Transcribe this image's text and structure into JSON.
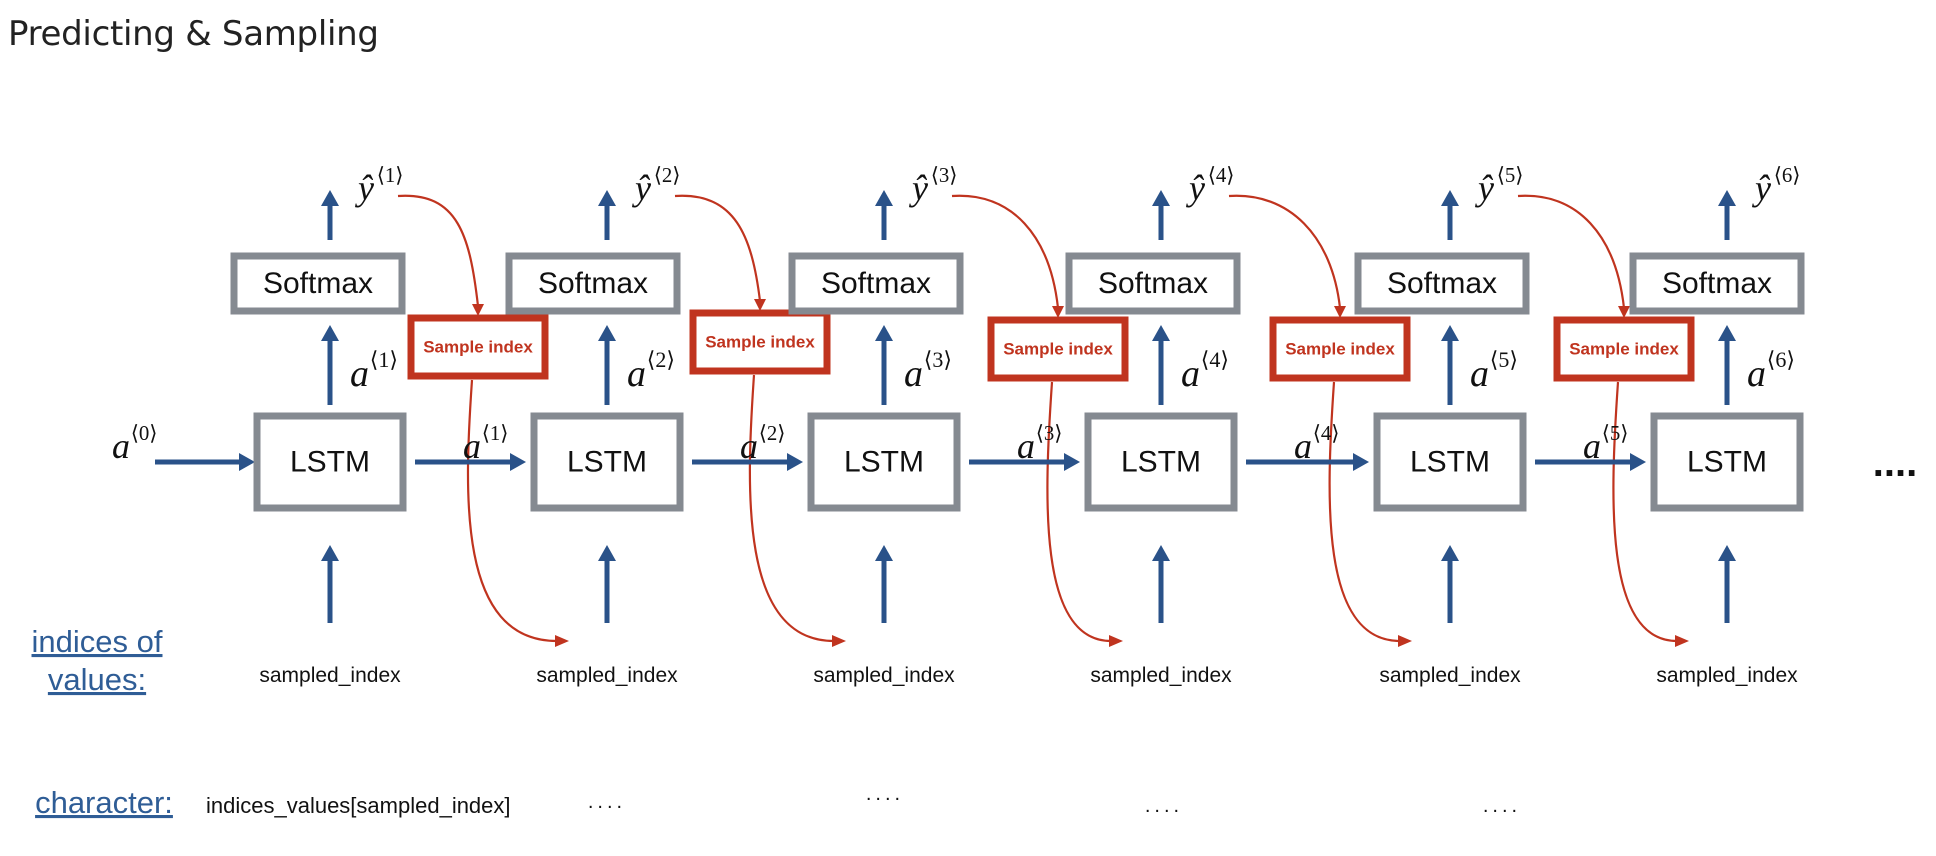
{
  "title": "Predicting & Sampling",
  "colors": {
    "box_border": "#858a91",
    "arrow_blue": "#2a5289",
    "sample_red": "#c0341f",
    "link_blue": "#2f5d96"
  },
  "initial_state": {
    "symbol": "a",
    "superscript": "⟨0⟩"
  },
  "steps": [
    {
      "index": 1,
      "softmax_label": "Softmax",
      "lstm_label": "LSTM",
      "output_symbol": "ŷ",
      "output_sup": "⟨1⟩",
      "activation_symbol": "a",
      "activation_sup": "⟨1⟩",
      "input_label": "sampled_index",
      "character": "indices_values[sampled_index]"
    },
    {
      "index": 2,
      "softmax_label": "Softmax",
      "lstm_label": "LSTM",
      "output_symbol": "ŷ",
      "output_sup": "⟨2⟩",
      "activation_symbol": "a",
      "activation_sup": "⟨2⟩",
      "input_label": "sampled_index",
      "character": "...."
    },
    {
      "index": 3,
      "softmax_label": "Softmax",
      "lstm_label": "LSTM",
      "output_symbol": "ŷ",
      "output_sup": "⟨3⟩",
      "activation_symbol": "a",
      "activation_sup": "⟨3⟩",
      "input_label": "sampled_index",
      "character": "...."
    },
    {
      "index": 4,
      "softmax_label": "Softmax",
      "lstm_label": "LSTM",
      "output_symbol": "ŷ",
      "output_sup": "⟨4⟩",
      "activation_symbol": "a",
      "activation_sup": "⟨4⟩",
      "input_label": "sampled_index",
      "character": "...."
    },
    {
      "index": 5,
      "softmax_label": "Softmax",
      "lstm_label": "LSTM",
      "output_symbol": "ŷ",
      "output_sup": "⟨5⟩",
      "activation_symbol": "a",
      "activation_sup": "⟨5⟩",
      "input_label": "sampled_index",
      "character": "...."
    },
    {
      "index": 6,
      "softmax_label": "Softmax",
      "lstm_label": "LSTM",
      "output_symbol": "ŷ",
      "output_sup": "⟨6⟩",
      "activation_symbol": "a",
      "activation_sup": "⟨6⟩",
      "input_label": "sampled_index",
      "character": ""
    }
  ],
  "sample_box_label": "Sample index",
  "continuation": "....",
  "row_labels": {
    "indices_line1": "indices of",
    "indices_line2": "values:",
    "character": "character:"
  }
}
